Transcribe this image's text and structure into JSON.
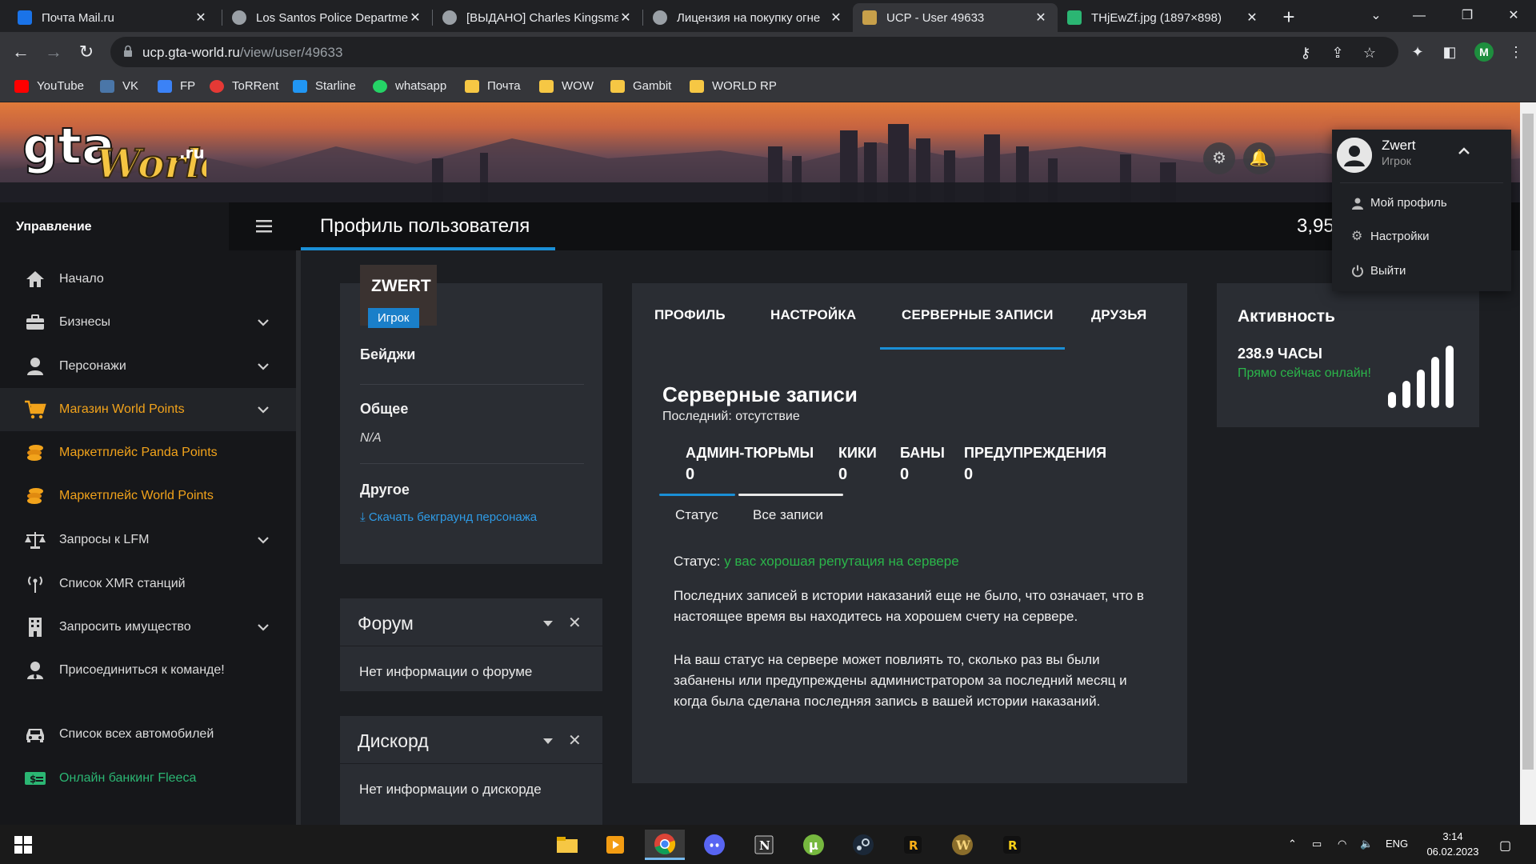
{
  "browser": {
    "tabs": [
      {
        "title": "Почта Mail.ru",
        "active": false,
        "favicon_color": "#1a73e8"
      },
      {
        "title": "Los Santos Police Departme",
        "active": false,
        "favicon_color": "#9aa0a6"
      },
      {
        "title": "[ВЫДАНО] Charles Kingsma",
        "active": false,
        "favicon_color": "#9aa0a6"
      },
      {
        "title": "Лицензия на покупку огне",
        "active": false,
        "favicon_color": "#9aa0a6"
      },
      {
        "title": "UCP - User 49633",
        "active": true,
        "favicon_color": "#c8a04a"
      },
      {
        "title": "THjEwZf.jpg (1897×898)",
        "active": false,
        "favicon_color": "#2bb673"
      }
    ],
    "url_host": "ucp.gta-world.ru",
    "url_path": "/view/user/49633",
    "profile_initial": "M",
    "bookmarks": [
      {
        "label": "YouTube",
        "icon": "youtube-icon",
        "color": "#ff0000"
      },
      {
        "label": "VK",
        "icon": "vk-icon",
        "color": "#4a76a8"
      },
      {
        "label": "FP",
        "icon": "fp-icon",
        "color": "#3b82f6"
      },
      {
        "label": "ToRRent",
        "icon": "torrent-icon",
        "color": "#e53935"
      },
      {
        "label": "Starline",
        "icon": "starline-icon",
        "color": "#2196f3"
      },
      {
        "label": "whatsapp",
        "icon": "whatsapp-icon",
        "color": "#25d366"
      },
      {
        "label": "Почта",
        "icon": "folder-icon",
        "color": "#f6c744"
      },
      {
        "label": "WOW",
        "icon": "folder-icon",
        "color": "#f6c744"
      },
      {
        "label": "Gambit",
        "icon": "folder-icon",
        "color": "#f6c744"
      },
      {
        "label": "WORLD RP",
        "icon": "folder-icon",
        "color": "#f6c744"
      }
    ]
  },
  "logo": {
    "text": "gta",
    "script": "World",
    "suffix": ".ru"
  },
  "sidebar": {
    "heading": "Управление",
    "items": [
      {
        "label": "Начало",
        "icon": "home-icon",
        "expandable": false
      },
      {
        "label": "Бизнесы",
        "icon": "briefcase-icon",
        "expandable": true
      },
      {
        "label": "Персонажи",
        "icon": "user-icon",
        "expandable": true
      },
      {
        "label": "Магазин World Points",
        "icon": "cart-icon",
        "expandable": true
      },
      {
        "label": "Маркетплейс Panda Points",
        "icon": "coins-icon",
        "expandable": false
      },
      {
        "label": "Маркетплейс World Points",
        "icon": "coins-icon",
        "expandable": false
      },
      {
        "label": "Запросы к LFM",
        "icon": "scales-icon",
        "expandable": true
      },
      {
        "label": "Список XMR станций",
        "icon": "antenna-icon",
        "expandable": false
      },
      {
        "label": "Запросить имущество",
        "icon": "building-icon",
        "expandable": true
      },
      {
        "label": "Присоединиться к команде!",
        "icon": "user-tie-icon",
        "expandable": false
      },
      {
        "label": "Список всех автомобилей",
        "icon": "car-icon",
        "expandable": false
      },
      {
        "label": "Онлайн банкинг Fleeca",
        "icon": "money-icon",
        "expandable": false
      }
    ]
  },
  "header": {
    "title": "Профиль пользователя",
    "points": "3,95"
  },
  "profile": {
    "username": "ZWERT",
    "role": "Игрок",
    "badges_heading": "Бейджи",
    "general_heading": "Общее",
    "general_value": "N/A",
    "other_heading": "Другое",
    "download_link": "Скачать бекграунд персонажа"
  },
  "widgets": {
    "forum": {
      "title": "Форум",
      "body": "Нет информации о форуме"
    },
    "discord": {
      "title": "Дискорд",
      "body": "Нет информации о дискорде"
    }
  },
  "main": {
    "tabs": [
      "ПРОФИЛЬ",
      "НАСТРОЙКА",
      "СЕРВЕРНЫЕ ЗАПИСИ",
      "ДРУЗЬЯ"
    ],
    "active_tab": "СЕРВЕРНЫЕ ЗАПИСИ",
    "title": "Серверные записи",
    "subtitle": "Последний: отсутствие",
    "stats": [
      {
        "label": "АДМИН-ТЮРЬМЫ",
        "value": "0"
      },
      {
        "label": "КИКИ",
        "value": "0"
      },
      {
        "label": "БАНЫ",
        "value": "0"
      },
      {
        "label": "ПРЕДУПРЕЖДЕНИЯ",
        "value": "0"
      }
    ],
    "subtabs": [
      "Статус",
      "Все записи"
    ],
    "status_label": "Статус:",
    "status_value": "у вас хорошая репутация на сервере",
    "para1": "Последних записей в истории наказаний еще не было, что означает, что в настоящее время вы находитесь на хорошем счету на сервере.",
    "para2": "На ваш статус на сервере может повлиять то, сколько раз вы были забанены или предупреждены администратором за последний месяц и когда была сделана последняя запись в вашей истории наказаний."
  },
  "activity": {
    "title": "Активность",
    "hours": "238.9 ЧАСЫ",
    "online": "Прямо сейчас онлайн!"
  },
  "user_menu": {
    "name": "Zwert",
    "role": "Игрок",
    "items": [
      {
        "label": "Мой профиль",
        "icon": "user-icon"
      },
      {
        "label": "Настройки",
        "icon": "gear-icon"
      },
      {
        "label": "Выйти",
        "icon": "power-icon"
      }
    ]
  },
  "taskbar": {
    "language": "ENG",
    "time": "3:14",
    "date": "06.02.2023"
  },
  "colors": {
    "accent": "#1a8fd6",
    "orange": "#f2a31b",
    "green": "#2bb54a"
  }
}
